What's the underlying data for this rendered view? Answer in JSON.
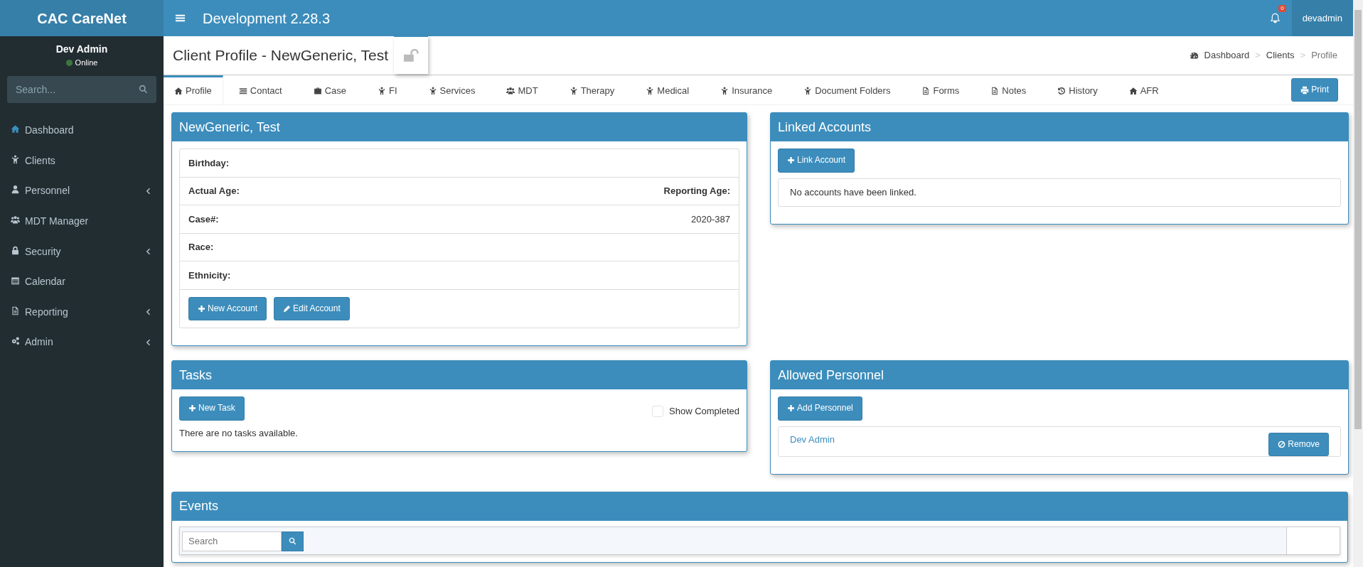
{
  "topbar": {
    "brand": "CAC CareNet",
    "title": "Development 2.28.3",
    "notification_count": "0",
    "user": "devadmin"
  },
  "sidebar": {
    "user": "Dev Admin",
    "status": "Online",
    "search": {
      "placeholder": "Search..."
    },
    "items": [
      {
        "label": "Dashboard",
        "has_submenu": false
      },
      {
        "label": "Clients",
        "has_submenu": false
      },
      {
        "label": "Personnel",
        "has_submenu": true
      },
      {
        "label": "MDT Manager",
        "has_submenu": false
      },
      {
        "label": "Security",
        "has_submenu": true
      },
      {
        "label": "Calendar",
        "has_submenu": false
      },
      {
        "label": "Reporting",
        "has_submenu": true
      },
      {
        "label": "Admin",
        "has_submenu": true
      }
    ]
  },
  "header": {
    "title": "Client Profile - NewGeneric, Test",
    "locked": false,
    "breadcrumb": {
      "separator": ">",
      "items": [
        "Dashboard",
        "Clients",
        "Profile"
      ]
    }
  },
  "tabs": [
    {
      "label": "Profile",
      "selected": true
    },
    {
      "label": "Contact",
      "selected": false
    },
    {
      "label": "Case",
      "selected": false
    },
    {
      "label": "FI",
      "selected": false
    },
    {
      "label": "Services",
      "selected": false
    },
    {
      "label": "MDT",
      "selected": false
    },
    {
      "label": "Therapy",
      "selected": false
    },
    {
      "label": "Medical",
      "selected": false
    },
    {
      "label": "Insurance",
      "selected": false
    },
    {
      "label": "Document Folders",
      "selected": false
    },
    {
      "label": "Forms",
      "selected": false
    },
    {
      "label": "Notes",
      "selected": false
    },
    {
      "label": "History",
      "selected": false
    },
    {
      "label": "AFR",
      "selected": false
    }
  ],
  "print_button": "Print",
  "profile": {
    "title": "NewGeneric, Test",
    "fields": [
      {
        "label": "Birthday:"
      },
      {
        "label": "Actual Age:",
        "right_label": "Reporting Age:"
      },
      {
        "label": "Case#:",
        "value": "2020-387"
      },
      {
        "label": "Race:"
      },
      {
        "label": "Ethnicity:"
      }
    ],
    "buttons": [
      "New Account",
      "Edit Account"
    ]
  },
  "linked_accounts": {
    "title": "Linked Accounts",
    "button": "Link Account",
    "empty": "No accounts have been linked."
  },
  "tasks": {
    "title": "Tasks",
    "button": "New Task",
    "show_completed": {
      "label": "Show Completed",
      "checked": false
    },
    "empty": "There are no tasks available."
  },
  "allowed_personnel": {
    "title": "Allowed Personnel",
    "button": "Add Personnel",
    "items": [
      {
        "name": "Dev Admin",
        "action": "Remove"
      }
    ]
  },
  "events": {
    "title": "Events",
    "search": {
      "placeholder": "Search"
    }
  }
}
